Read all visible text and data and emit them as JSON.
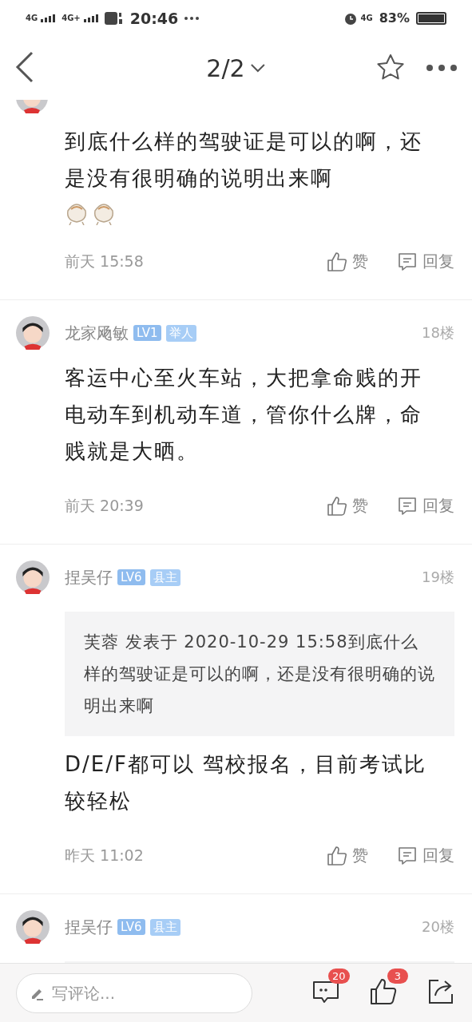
{
  "status_bar": {
    "network": "4G",
    "network_2": "4G+",
    "time": "20:46",
    "network_3": "4G",
    "battery": "83%"
  },
  "nav": {
    "page": "2/2"
  },
  "posts": [
    {
      "kind": "partial",
      "body": "到底什么样的驾驶证是可以的啊，还是没有很明确的说明出来啊",
      "stickers": true,
      "time": "前天 15:58",
      "like": "赞",
      "reply": "回复"
    },
    {
      "kind": "full",
      "user": "龙家飏敏",
      "badges": [
        {
          "label": "LV1",
          "kind": "level"
        },
        {
          "label": "举人",
          "kind": "title"
        }
      ],
      "floor": "18楼",
      "body": "客运中心至火车站，大把拿命贱的开电动车到机动车道，管你什么牌，命贱就是大晒。",
      "stickers": false,
      "time": "前天 20:39",
      "like": "赞",
      "reply": "回复"
    },
    {
      "kind": "full",
      "user": "捏吴仔",
      "badges": [
        {
          "label": "LV6",
          "kind": "level"
        },
        {
          "label": "县主",
          "kind": "title"
        }
      ],
      "floor": "19楼",
      "quote": "芙蓉 发表于 2020-10-29 15:58到底什么样的驾驶证是可以的啊，还是没有很明确的说明出来啊",
      "body": "D/E/F都可以 驾校报名，目前考试比较轻松",
      "stickers": false,
      "time": "昨天 11:02",
      "like": "赞",
      "reply": "回复"
    },
    {
      "kind": "cut",
      "user": "捏吴仔",
      "badges": [
        {
          "label": "LV6",
          "kind": "level"
        },
        {
          "label": "县主",
          "kind": "title"
        }
      ],
      "floor": "20楼"
    }
  ],
  "bottom_bar": {
    "placeholder": "写评论...",
    "comments": "20",
    "likes": "3"
  }
}
